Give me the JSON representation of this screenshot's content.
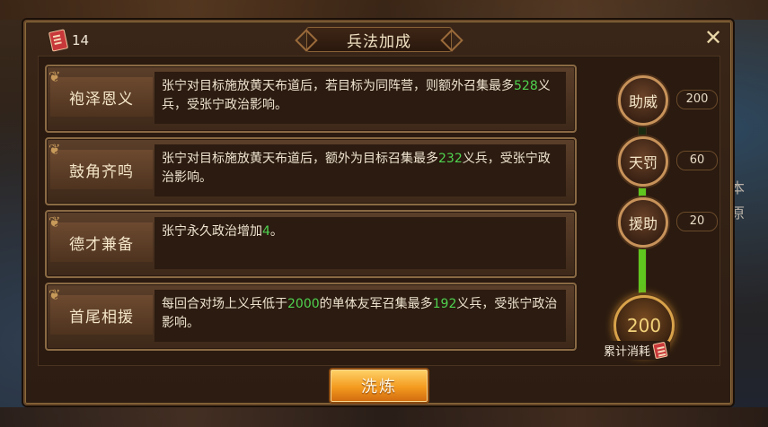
{
  "dialog": {
    "title": "兵法加成",
    "scroll_count": "14",
    "refine_button": "洗炼"
  },
  "skills": [
    {
      "name": "袍泽恩义",
      "desc": [
        {
          "text": "张宁对目标施放黄天布道后，若目标为同阵营，则额外召集最多"
        },
        {
          "text": "528",
          "highlight": true
        },
        {
          "text": "义兵，受张宁政治影响。"
        }
      ]
    },
    {
      "name": "鼓角齐鸣",
      "desc": [
        {
          "text": "张宁对目标施放黄天布道后，额外为目标召集最多"
        },
        {
          "text": "232",
          "highlight": true
        },
        {
          "text": "义兵，受张宁政治影响。"
        }
      ]
    },
    {
      "name": "德才兼备",
      "desc": [
        {
          "text": "张宁永久政治增加"
        },
        {
          "text": "4",
          "highlight": true
        },
        {
          "text": "。"
        }
      ]
    },
    {
      "name": "首尾相援",
      "desc": [
        {
          "text": "每回合对场上义兵低于"
        },
        {
          "text": "2000",
          "highlight": true
        },
        {
          "text": "的单体友军召集最多"
        },
        {
          "text": "192",
          "highlight": true
        },
        {
          "text": "义兵，受张宁政治影响。"
        }
      ]
    }
  ],
  "tiers": [
    {
      "label": "助威",
      "cost": "200"
    },
    {
      "label": "天罚",
      "cost": "60"
    },
    {
      "label": "援助",
      "cost": "20"
    }
  ],
  "total": {
    "value": "200",
    "label": "累计消耗"
  },
  "progress_fraction": 0.75,
  "background_glyphs": [
    "本",
    "原"
  ],
  "colors": {
    "highlight": "#4fd24f",
    "accent": "#c7925a",
    "progress": "#5fc51f"
  }
}
